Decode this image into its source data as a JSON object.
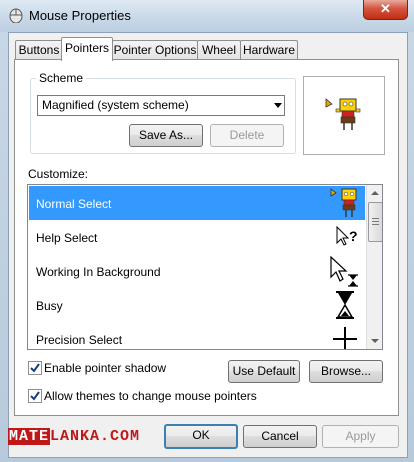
{
  "window": {
    "title": "Mouse Properties",
    "close_label": "✕"
  },
  "tabs": [
    {
      "label": "Buttons",
      "active": false
    },
    {
      "label": "Pointers",
      "active": true
    },
    {
      "label": "Pointer Options",
      "active": false
    },
    {
      "label": "Wheel",
      "active": false
    },
    {
      "label": "Hardware",
      "active": false
    }
  ],
  "scheme": {
    "label": "Scheme",
    "selected": "Magnified (system scheme)",
    "save_as_label": "Save As...",
    "delete_label": "Delete"
  },
  "customize": {
    "label": "Customize:",
    "rows": [
      {
        "label": "Normal Select",
        "icon": "cartoon-arrow-icon",
        "selected": true
      },
      {
        "label": "Help Select",
        "icon": "help-cursor-icon",
        "selected": false
      },
      {
        "label": "Working In Background",
        "icon": "working-cursor-icon",
        "selected": false
      },
      {
        "label": "Busy",
        "icon": "hourglass-icon",
        "selected": false
      },
      {
        "label": "Precision Select",
        "icon": "crosshair-icon",
        "selected": false
      }
    ]
  },
  "options": {
    "shadow_label": "Enable pointer shadow",
    "shadow_checked": true,
    "themes_label": "Allow themes to change mouse pointers",
    "themes_checked": true,
    "use_default_label": "Use Default",
    "browse_label": "Browse..."
  },
  "footer": {
    "ok_label": "OK",
    "cancel_label": "Cancel",
    "apply_label": "Apply"
  },
  "watermark": {
    "part1": "MATE",
    "part2": "LANKA.COM"
  },
  "colors": {
    "selection": "#3399ff",
    "accent_red": "#c01818"
  }
}
